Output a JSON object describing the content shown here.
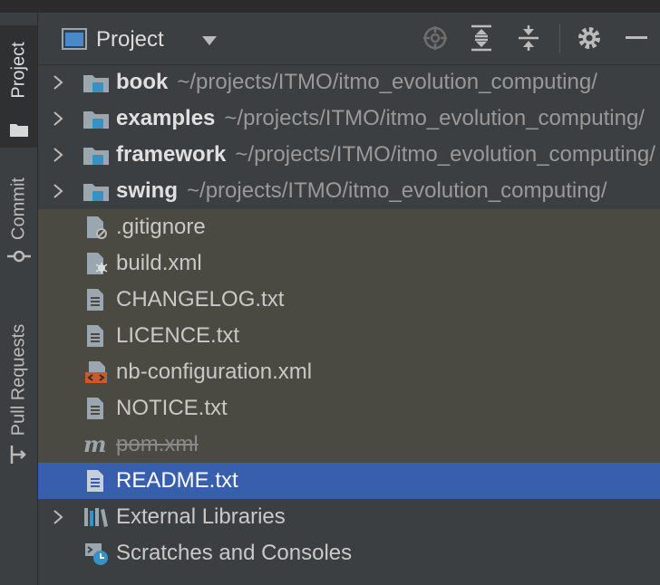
{
  "toolwindow": {
    "left_tabs": [
      {
        "label": "Project",
        "icon": "folder-icon"
      },
      {
        "label": "Commit",
        "icon": "commit-icon"
      },
      {
        "label": "Pull Requests",
        "icon": "pull-request-icon"
      }
    ],
    "header": {
      "title": "Project",
      "icons": [
        "project-view-icon",
        "chevron-down-icon",
        "locate-icon",
        "expand-all-icon",
        "collapse-all-icon",
        "gear-icon",
        "minimize-icon"
      ]
    }
  },
  "tree": {
    "modules": [
      {
        "name": "book",
        "path": "~/projects/ITMO/itmo_evolution_computing/"
      },
      {
        "name": "examples",
        "path": "~/projects/ITMO/itmo_evolution_computing/"
      },
      {
        "name": "framework",
        "path": "~/projects/ITMO/itmo_evolution_computing/"
      },
      {
        "name": "swing",
        "path": "~/projects/ITMO/itmo_evolution_computing/"
      }
    ],
    "files": [
      {
        "name": ".gitignore",
        "icon": "gitignore-file-icon"
      },
      {
        "name": "build.xml",
        "icon": "ant-build-file-icon"
      },
      {
        "name": "CHANGELOG.txt",
        "icon": "text-file-icon"
      },
      {
        "name": "LICENCE.txt",
        "icon": "text-file-icon"
      },
      {
        "name": "nb-configuration.xml",
        "icon": "xml-file-icon"
      },
      {
        "name": "NOTICE.txt",
        "icon": "text-file-icon"
      },
      {
        "name": "pom.xml",
        "icon": "maven-icon"
      },
      {
        "name": "README.txt",
        "icon": "text-file-icon"
      }
    ],
    "extra": [
      {
        "name": "External Libraries",
        "icon": "libraries-icon"
      },
      {
        "name": "Scratches and Consoles",
        "icon": "scratches-icon"
      }
    ],
    "selected": "README.txt",
    "ignored": "pom.xml"
  },
  "colors": {
    "background": "#3c3f41",
    "excluded_row": "#4b4a42",
    "selection": "#375fae",
    "folder_blue": "#3592c4"
  }
}
